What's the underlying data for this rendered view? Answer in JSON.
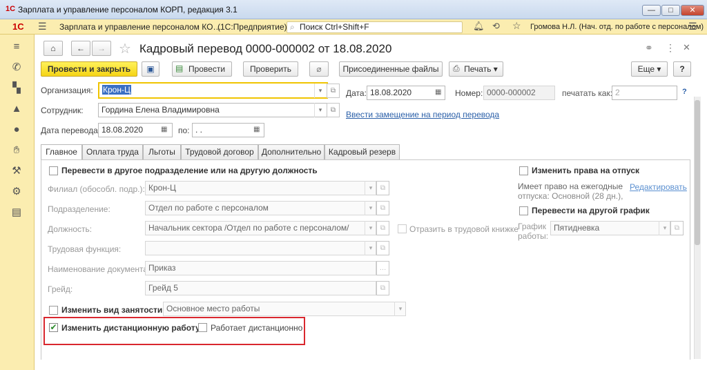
{
  "window": {
    "title": "Зарплата и управление персоналом КОРП, редакция 3.1",
    "logo": "1С",
    "min": "—",
    "max": "□",
    "close": "✕"
  },
  "appbar": {
    "logo": "1С",
    "app": "Зарплата и управление персоналом КО…",
    "platform": "(1С:Предприятие)",
    "search_placeholder": "Поиск Ctrl+Shift+F",
    "user": "Громова Н.Л. (Нач. отд. по работе с персоналом)"
  },
  "sidebar": {
    "items": [
      "menu-icon",
      "phone-icon",
      "gift-icon",
      "education-icon",
      "people-icon",
      "hand-icon",
      "wrench-icon",
      "gear-icon",
      "card-icon"
    ]
  },
  "doc": {
    "title": "Кадровый перевод 0000-000002 от 18.08.2020",
    "toolbar": {
      "post_close": "Провести и закрыть",
      "post": "Провести",
      "check": "Проверить",
      "attached": "Присоединенные файлы",
      "print": "Печать",
      "more": "Еще",
      "help": "?"
    },
    "fields": {
      "org_label": "Организация:",
      "org_value": "Крон-Ц",
      "emp_label": "Сотрудник:",
      "emp_value": "Гордина Елена Владимировна",
      "date_move_label": "Дата перевода:",
      "date_move_value": "18.08.2020",
      "to_label": "по:",
      "to_value": ". .",
      "date_label": "Дата:",
      "date_value": "18.08.2020",
      "num_label": "Номер:",
      "num_value": "0000-000002",
      "print_as_label": "печатать как:",
      "print_as_value": "2",
      "print_help": "?",
      "replacement_link": "Ввести замещение на период перевода"
    },
    "tabs": [
      "Главное",
      "Оплата труда",
      "Льготы",
      "Трудовой договор",
      "Дополнительно",
      "Кадровый резерв"
    ],
    "main": {
      "move_cb": "Перевести в другое подразделение или на другую должность",
      "branch_label": "Филиал (обособл. подр.):",
      "branch_value": "Крон-Ц",
      "dept_label": "Подразделение:",
      "dept_value": "Отдел по работе с персоналом",
      "pos_label": "Должность:",
      "pos_value": "Начальник сектора /Отдел по работе с персоналом/",
      "func_label": "Трудовая функция:",
      "func_value": "",
      "docname_label": "Наименование документа:",
      "docname_value": "Приказ",
      "grade_label": "Грейд:",
      "grade_value": "Грейд 5",
      "workbook_cb": "Отразить в трудовой книжке",
      "employment_cb": "Изменить вид занятости",
      "employment_value": "Основное место работы",
      "remote_cb": "Изменить дистанционную работу",
      "remote_checked": true,
      "works_remote_cb": "Работает дистанционно",
      "vacation_cb": "Изменить права на отпуск",
      "vacation_info1": "Имеет право на ежегодные",
      "vacation_info2": "отпуска: Основной (28 дн.),",
      "edit_link": "Редактировать",
      "schedule_cb": "Перевести на другой график",
      "schedule_label1": "График",
      "schedule_label2": "работы:",
      "schedule_value": "Пятидневка"
    }
  },
  "colors": {
    "accent_yellow": "#f5d416",
    "panel": "#fbedb0",
    "highlight_box": "#d9272e",
    "link": "#2a5fa8"
  }
}
